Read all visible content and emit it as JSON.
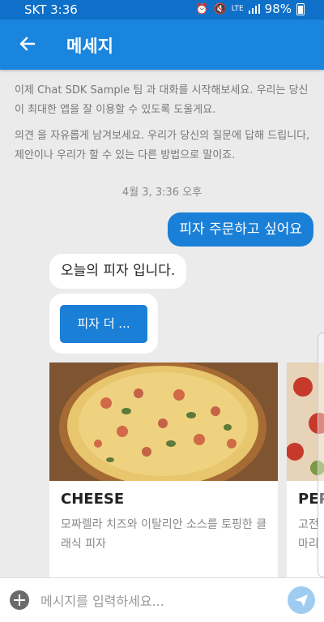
{
  "status_bar": {
    "carrier": "SKT 3:36",
    "network": "LTE",
    "battery": "98%",
    "icons": [
      "alarm-icon",
      "mute-icon",
      "lte-icon",
      "signal-icon",
      "battery-icon"
    ]
  },
  "app_bar": {
    "title": "메세지",
    "back_icon": "arrow-back-icon"
  },
  "intro": {
    "line1": "이제 Chat SDK Sample 팀 과 대화를 시작해보세요. 우리는 당신이 최대한 앱을 잘 이용할 수 있도록 도울게요.",
    "line2": "의견 을 자유롭게 남겨보세요. 우리가 당신의 질문에 답해 드립니다, 제안이나 우리가 할 수 있는 다른 방법으로 말이죠."
  },
  "conversation": {
    "timestamp": "4월 3, 3:36 오후",
    "user_message": "피자 주문하고 싶어요",
    "bot_message": "오늘의 피자 입니다.",
    "action_button": "피자 더 ..."
  },
  "carousel": {
    "cards": [
      {
        "name": "CHEESE",
        "description": "모짜렐라 치즈와 이탈리안 소스를 토핑한 클래식 피자"
      },
      {
        "name": "PEP",
        "description": "고전 마리"
      }
    ]
  },
  "composer": {
    "placeholder": "메시지를 입력하세요...",
    "add_icon": "plus-circle-icon",
    "send_icon": "send-icon"
  },
  "colors": {
    "status_bar": "#0e70c8",
    "app_bar": "#1a85de",
    "accent": "#1a7fd7",
    "background": "#ebebeb"
  }
}
